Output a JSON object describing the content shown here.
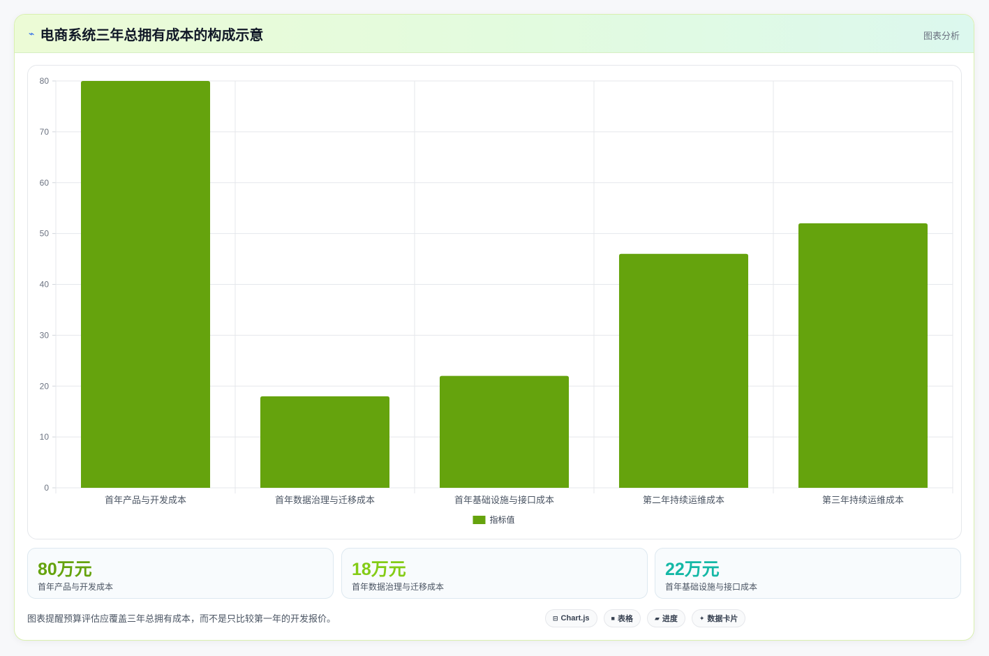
{
  "header": {
    "icon": "trend-line-icon",
    "title": "电商系统三年总拥有成本的构成示意",
    "link_label": "图表分析"
  },
  "chart_data": {
    "type": "bar",
    "categories": [
      "首年产品与开发成本",
      "首年数据治理与迁移成本",
      "首年基础设施与接口成本",
      "第二年持续运维成本",
      "第三年持续运维成本"
    ],
    "series": [
      {
        "name": "指标值",
        "values": [
          80,
          18,
          22,
          46,
          52
        ],
        "color": "#65a30d"
      }
    ],
    "ylim": [
      0,
      80
    ],
    "yticks": [
      0,
      10,
      20,
      30,
      40,
      50,
      60,
      70,
      80
    ],
    "grid": true,
    "legend": "bottom"
  },
  "stats": [
    {
      "value": "80万元",
      "label": "首年产品与开发成本",
      "color": "#65a30d"
    },
    {
      "value": "18万元",
      "label": "首年数据治理与迁移成本",
      "color": "#84cc16"
    },
    {
      "value": "22万元",
      "label": "首年基础设施与接口成本",
      "color": "#14b8a6"
    }
  ],
  "footnote": "图表提醒预算评估应覆盖三年总拥有成本，而不是只比较第一年的开发报价。",
  "chips": [
    {
      "icon": "chart-icon",
      "glyph": "⊟",
      "label": "Chart.js"
    },
    {
      "icon": "table-icon",
      "glyph": "■",
      "label": "表格"
    },
    {
      "icon": "progress-icon",
      "glyph": "▰",
      "label": "进度"
    },
    {
      "icon": "sparkle-icon",
      "glyph": "✦",
      "label": "数据卡片"
    }
  ]
}
